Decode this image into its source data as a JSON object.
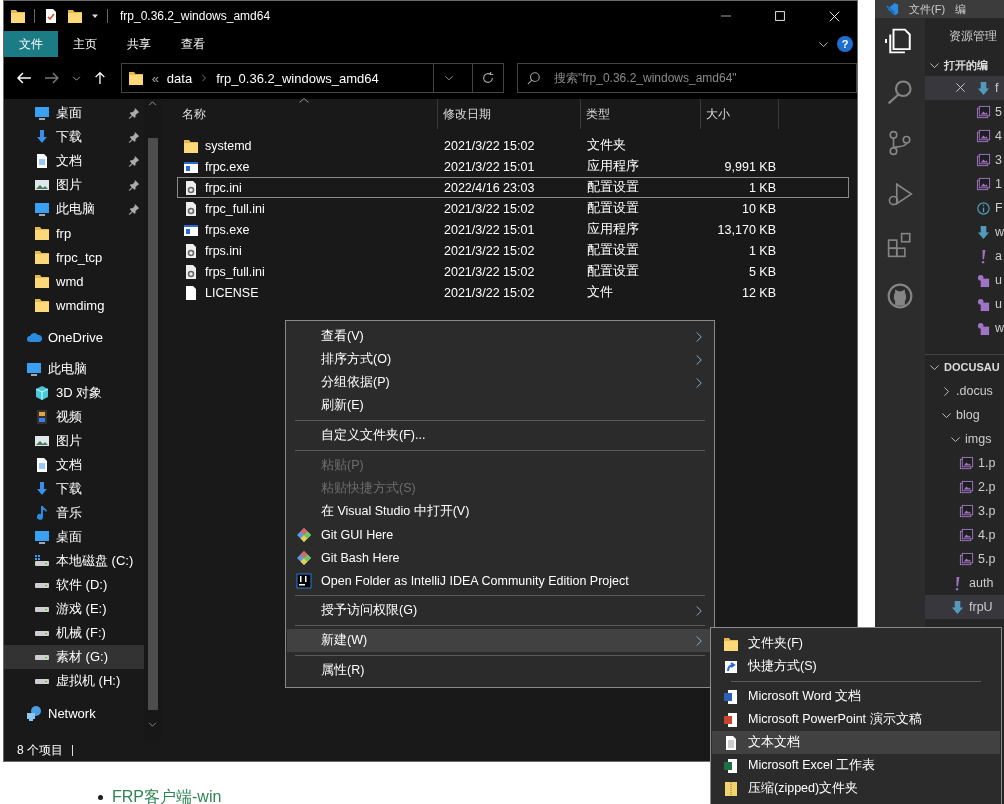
{
  "explorer": {
    "title": "frp_0.36.2_windows_amd64",
    "ribbon_tabs": [
      {
        "label": "文件",
        "selected": true
      },
      {
        "label": "主页",
        "selected": false
      },
      {
        "label": "共享",
        "selected": false
      },
      {
        "label": "查看",
        "selected": false
      }
    ],
    "help": "?",
    "address": {
      "overflow": "«",
      "segments": [
        "data",
        "frp_0.36.2_windows_amd64"
      ]
    },
    "search": {
      "placeholder": "搜索\"frp_0.36.2_windows_amd64\""
    },
    "quick_access": [
      {
        "label": "桌面",
        "kind": "desktop",
        "pinned": true,
        "selected": false
      },
      {
        "label": "下载",
        "kind": "download",
        "pinned": true,
        "selected": false
      },
      {
        "label": "文档",
        "kind": "document",
        "pinned": true,
        "selected": false
      },
      {
        "label": "图片",
        "kind": "pictures",
        "pinned": true,
        "selected": false
      },
      {
        "label": "此电脑",
        "kind": "desktop",
        "pinned": true,
        "selected": false
      },
      {
        "label": "frp",
        "kind": "folder",
        "pinned": false,
        "selected": false
      },
      {
        "label": "frpc_tcp",
        "kind": "folder",
        "pinned": false,
        "selected": false
      },
      {
        "label": "wmd",
        "kind": "folder",
        "pinned": false,
        "selected": false
      },
      {
        "label": "wmdimg",
        "kind": "folder",
        "pinned": false,
        "selected": false
      }
    ],
    "tree": [
      {
        "label": "OneDrive",
        "kind": "cloud",
        "selected": false
      },
      {
        "label": "此电脑",
        "kind": "desktop",
        "selected": false,
        "children": [
          {
            "label": "3D 对象",
            "kind": "cube",
            "selected": false
          },
          {
            "label": "视频",
            "kind": "video",
            "selected": false
          },
          {
            "label": "图片",
            "kind": "pictures",
            "selected": false
          },
          {
            "label": "文档",
            "kind": "document",
            "selected": false
          },
          {
            "label": "下载",
            "kind": "download",
            "selected": false
          },
          {
            "label": "音乐",
            "kind": "music",
            "selected": false
          },
          {
            "label": "桌面",
            "kind": "desktop",
            "selected": false
          },
          {
            "label": "本地磁盘 (C:)",
            "kind": "sysdrive",
            "selected": false
          },
          {
            "label": "软件 (D:)",
            "kind": "drive",
            "selected": false
          },
          {
            "label": "游戏 (E:)",
            "kind": "drive",
            "selected": false
          },
          {
            "label": "机械 (F:)",
            "kind": "drive",
            "selected": false
          },
          {
            "label": "素材 (G:)",
            "kind": "drive",
            "selected": true
          },
          {
            "label": "虚拟机 (H:)",
            "kind": "drive",
            "selected": false
          }
        ]
      },
      {
        "label": "Network",
        "kind": "network",
        "selected": false
      }
    ],
    "columns": [
      "名称",
      "修改日期",
      "类型",
      "大小"
    ],
    "files": [
      {
        "name": "systemd",
        "date": "2021/3/22 15:02",
        "type": "文件夹",
        "kind": "folder",
        "focused": false
      },
      {
        "name": "frpc.exe",
        "date": "2021/3/22 15:01",
        "type": "应用程序",
        "size": "9,991 KB",
        "kind": "exe",
        "focused": false
      },
      {
        "name": "frpc.ini",
        "date": "2022/4/16 23:03",
        "type": "配置设置",
        "size": "1 KB",
        "kind": "ini",
        "focused": true
      },
      {
        "name": "frpc_full.ini",
        "date": "2021/3/22 15:02",
        "type": "配置设置",
        "size": "10 KB",
        "kind": "ini",
        "focused": false
      },
      {
        "name": "frps.exe",
        "date": "2021/3/22 15:01",
        "type": "应用程序",
        "size": "13,170 KB",
        "kind": "exe",
        "focused": false
      },
      {
        "name": "frps.ini",
        "date": "2021/3/22 15:02",
        "type": "配置设置",
        "size": "1 KB",
        "kind": "ini",
        "focused": false
      },
      {
        "name": "frps_full.ini",
        "date": "2021/3/22 15:02",
        "type": "配置设置",
        "size": "5 KB",
        "kind": "ini",
        "focused": false
      },
      {
        "name": "LICENSE",
        "date": "2021/3/22 15:02",
        "type": "文件",
        "size": "12 KB",
        "kind": "file",
        "focused": false
      }
    ],
    "status": "8 个项目"
  },
  "context_menu": {
    "items": [
      {
        "kind": "plain",
        "label": "查看(V)",
        "submenu": true,
        "disabled": false,
        "selected": false
      },
      {
        "kind": "plain",
        "label": "排序方式(O)",
        "submenu": true,
        "disabled": false,
        "selected": false
      },
      {
        "kind": "plain",
        "label": "分组依据(P)",
        "submenu": true,
        "disabled": false,
        "selected": false
      },
      {
        "kind": "plain",
        "label": "刷新(E)",
        "submenu": false,
        "disabled": false,
        "selected": false
      },
      {
        "kind": "separator"
      },
      {
        "kind": "plain",
        "label": "自定义文件夹(F)...",
        "submenu": false,
        "disabled": false,
        "selected": false
      },
      {
        "kind": "separator"
      },
      {
        "kind": "plain",
        "label": "粘贴(P)",
        "submenu": false,
        "disabled": true,
        "selected": false
      },
      {
        "kind": "plain",
        "label": "粘贴快捷方式(S)",
        "submenu": false,
        "disabled": true,
        "selected": false
      },
      {
        "kind": "plain",
        "label": "在 Visual Studio 中打开(V)",
        "submenu": false,
        "disabled": false,
        "selected": false
      },
      {
        "kind": "git",
        "label": "Git GUI Here",
        "submenu": false,
        "disabled": false,
        "selected": false
      },
      {
        "kind": "git",
        "label": "Git Bash Here",
        "submenu": false,
        "disabled": false,
        "selected": false
      },
      {
        "kind": "ide",
        "label": "Open Folder as IntelliJ IDEA Community Edition Project",
        "submenu": false,
        "disabled": false,
        "selected": false
      },
      {
        "kind": "separator"
      },
      {
        "kind": "plain",
        "label": "授予访问权限(G)",
        "submenu": true,
        "disabled": false,
        "selected": false
      },
      {
        "kind": "separator"
      },
      {
        "kind": "plain",
        "label": "新建(W)",
        "submenu": true,
        "disabled": false,
        "selected": true
      },
      {
        "kind": "separator"
      },
      {
        "kind": "plain",
        "label": "属性(R)",
        "submenu": false,
        "disabled": false,
        "selected": false
      }
    ]
  },
  "new_submenu": {
    "items": [
      {
        "kind": "folder",
        "label": "文件夹(F)",
        "selected": false
      },
      {
        "kind": "shortcut",
        "label": "快捷方式(S)",
        "selected": false
      },
      {
        "kind": "separator"
      },
      {
        "kind": "word",
        "label": "Microsoft Word 文档",
        "selected": false
      },
      {
        "kind": "powerpoint",
        "label": "Microsoft PowerPoint 演示文稿",
        "selected": false
      },
      {
        "kind": "text",
        "label": "文本文档",
        "selected": true
      },
      {
        "kind": "excel",
        "label": "Microsoft Excel 工作表",
        "selected": false
      },
      {
        "kind": "zip",
        "label": "压缩(zipped)文件夹",
        "selected": false
      }
    ]
  },
  "vscode": {
    "menu": [
      "文件(F)",
      "编"
    ],
    "sidebar_title": "资源管理",
    "open_editors": {
      "title": "打开的编",
      "expanded": true,
      "items": [
        {
          "label": "f",
          "kind": "markdown",
          "selected": true
        },
        {
          "label": "5",
          "kind": "image",
          "selected": false
        },
        {
          "label": "4",
          "kind": "image",
          "selected": false
        },
        {
          "label": "3",
          "kind": "image",
          "selected": false
        },
        {
          "label": "1",
          "kind": "image",
          "selected": false
        },
        {
          "label": "F",
          "kind": "info",
          "selected": false
        },
        {
          "label": "w",
          "kind": "markdown",
          "selected": false
        },
        {
          "label": "a",
          "kind": "yaml",
          "selected": false
        },
        {
          "label": "u",
          "kind": "shape",
          "selected": false
        },
        {
          "label": "u",
          "kind": "shape",
          "selected": false
        },
        {
          "label": "w",
          "kind": "shape",
          "selected": false
        }
      ]
    },
    "project": {
      "title": "DOCUSAU",
      "expanded": true,
      "tree": [
        {
          "label": ".docus",
          "kind": "folder",
          "expanded": false,
          "selected": false
        },
        {
          "label": "blog",
          "kind": "folder",
          "expanded": true,
          "selected": false,
          "children": [
            {
              "label": "imgs",
              "kind": "folder",
              "expanded": true,
              "selected": false,
              "children": [
                {
                  "label": "1.p",
                  "kind": "image",
                  "selected": false
                },
                {
                  "label": "2.p",
                  "kind": "image",
                  "selected": false
                },
                {
                  "label": "3.p",
                  "kind": "image",
                  "selected": false
                },
                {
                  "label": "4.p",
                  "kind": "image",
                  "selected": false
                },
                {
                  "label": "5.p",
                  "kind": "image",
                  "selected": false
                }
              ]
            },
            {
              "label": "auth",
              "kind": "yaml",
              "selected": false
            },
            {
              "label": "frpU",
              "kind": "markdown",
              "selected": true
            }
          ]
        }
      ]
    }
  },
  "page": {
    "link": "FRP客户端-win"
  }
}
